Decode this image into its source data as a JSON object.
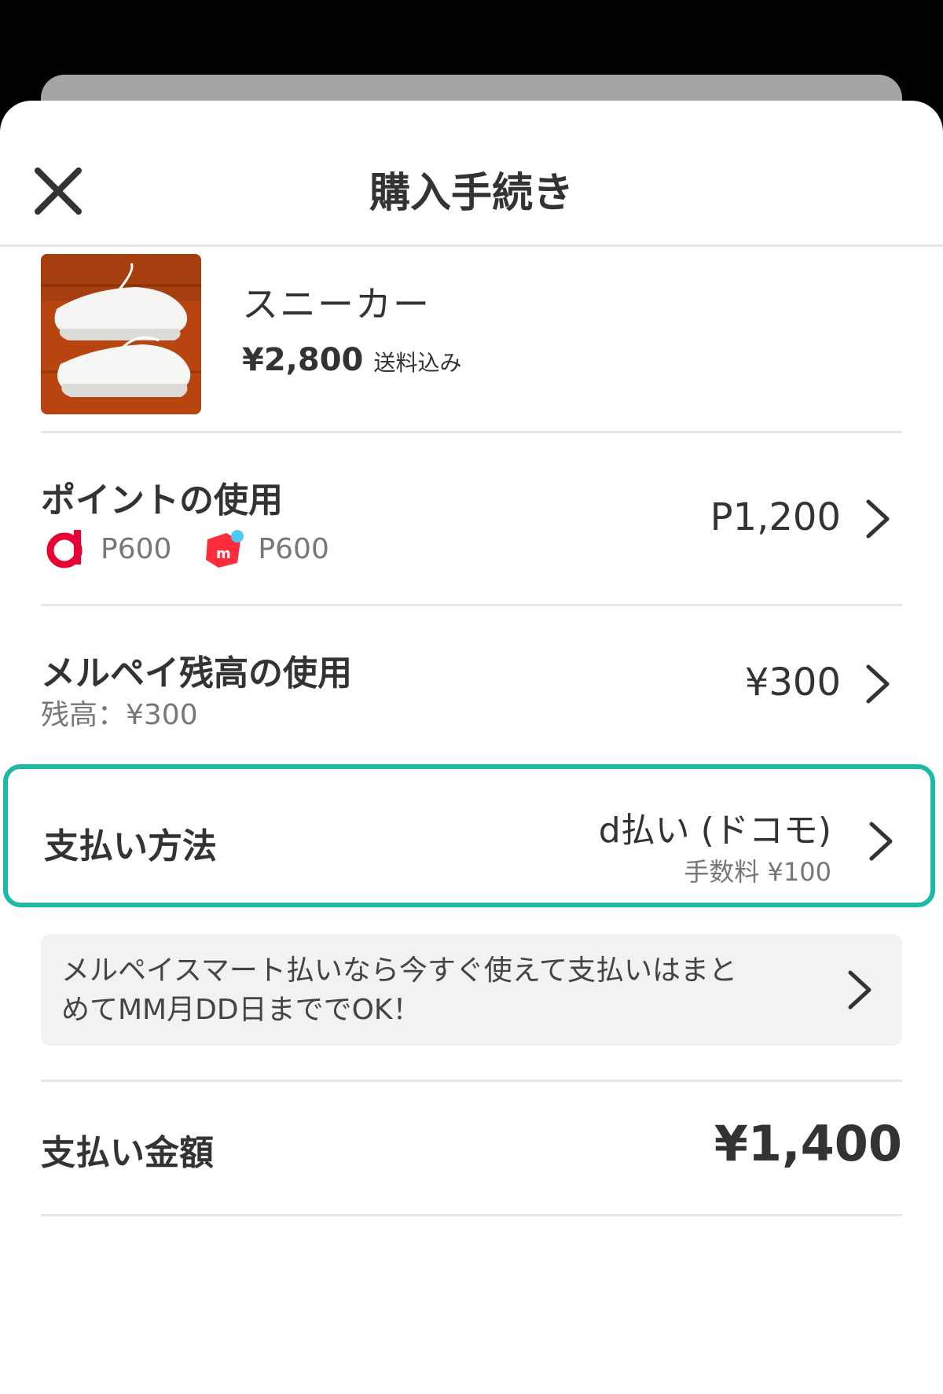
{
  "header": {
    "title": "購入手続き"
  },
  "product": {
    "name": "スニーカー",
    "price": "¥2,800",
    "shipping_note": "送料込み"
  },
  "points": {
    "title": "ポイントの使用",
    "value": "P1,200",
    "d_points": "P600",
    "mercari_points": "P600"
  },
  "merpay_balance": {
    "title": "メルペイ残高の使用",
    "sub": "残高：¥300",
    "value": "¥300"
  },
  "payment_method": {
    "title": "支払い方法",
    "value": "d払い (ドコモ)",
    "fee": "手数料 ¥100"
  },
  "promo": {
    "text": "メルペイスマート払いなら今すぐ使えて支払いはまとめてMM月DD日まででOK！"
  },
  "total": {
    "title": "支払い金額",
    "value": "¥1,400"
  },
  "colors": {
    "highlight": "#1db9a5",
    "d_brand": "#e60033",
    "mercari_brand": "#ff2c3c",
    "mercari_dot": "#4dc9f6"
  },
  "icons": {
    "close": "close-icon",
    "chevron": "chevron-right-icon",
    "d_point": "d-point-icon",
    "mercari_point": "mercari-point-icon"
  }
}
